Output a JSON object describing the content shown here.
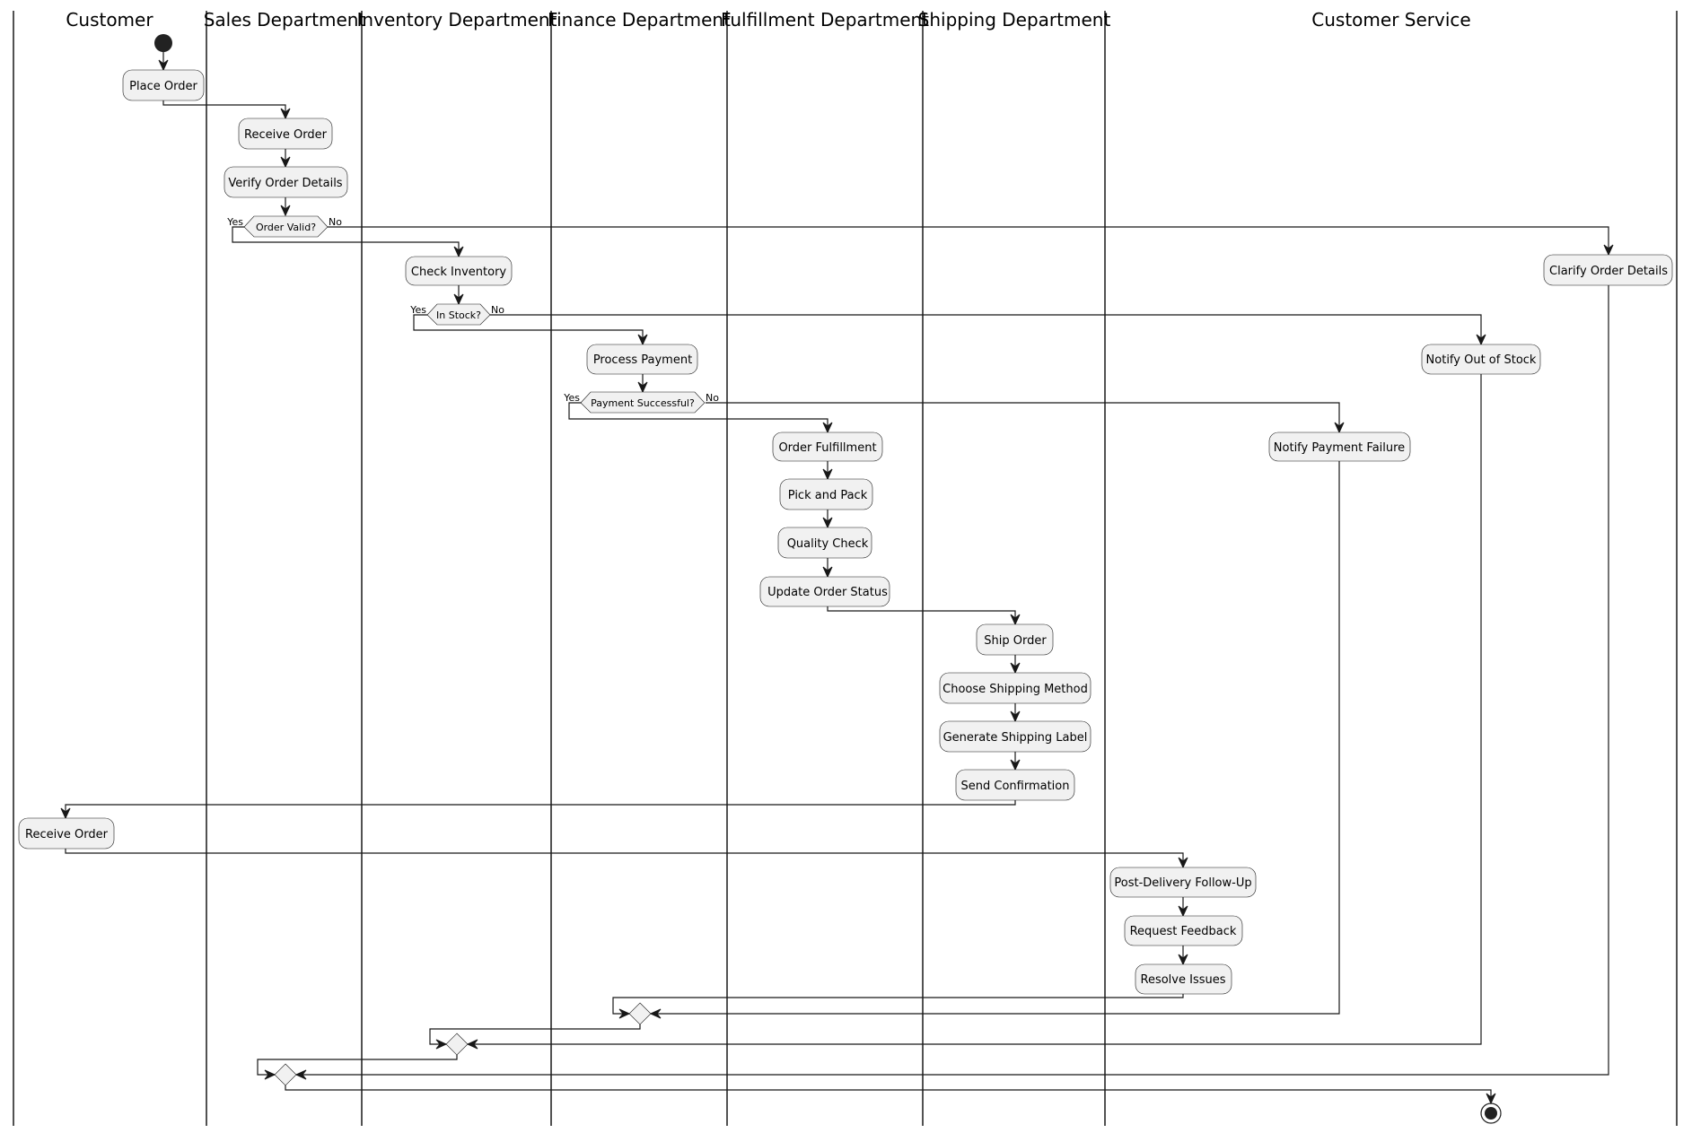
{
  "diagram": {
    "type": "swimlane-activity",
    "lanes": [
      {
        "id": "customer",
        "title": "Customer"
      },
      {
        "id": "sales",
        "title": "Sales Department"
      },
      {
        "id": "inventory",
        "title": "Inventory Department"
      },
      {
        "id": "finance",
        "title": "Finance Department"
      },
      {
        "id": "fulfillment",
        "title": "Fulfillment Department"
      },
      {
        "id": "shipping",
        "title": "Shipping Department"
      },
      {
        "id": "service",
        "title": "Customer Service"
      }
    ],
    "activities": {
      "place_order": "Place Order",
      "receive_order_sales": "Receive Order",
      "verify_order_details": "Verify Order Details",
      "check_inventory": "Check Inventory",
      "clarify_order_details": "Clarify Order Details",
      "process_payment": "Process Payment",
      "notify_out_of_stock": "Notify Out of Stock",
      "order_fulfillment": "Order Fulfillment",
      "notify_payment_failure": "Notify Payment Failure",
      "pick_and_pack": "Pick and Pack",
      "quality_check": "Quality Check",
      "update_order_status": "Update Order Status",
      "ship_order": "Ship Order",
      "choose_shipping_method": "Choose Shipping Method",
      "generate_shipping_label": "Generate Shipping Label",
      "send_confirmation": "Send Confirmation",
      "receive_order_customer": "Receive Order",
      "post_delivery_follow_up": "Post-Delivery Follow-Up",
      "request_feedback": "Request Feedback",
      "resolve_issues": "Resolve Issues"
    },
    "decisions": {
      "order_valid": {
        "question": "Order Valid?",
        "yes": "Yes",
        "no": "No"
      },
      "in_stock": {
        "question": "In Stock?",
        "yes": "Yes",
        "no": "No"
      },
      "payment_successful": {
        "question": "Payment Successful?",
        "yes": "Yes",
        "no": "No"
      }
    },
    "colors": {
      "activity_fill": "#f1f1f1",
      "line": "#181818",
      "node": "#222222"
    }
  }
}
